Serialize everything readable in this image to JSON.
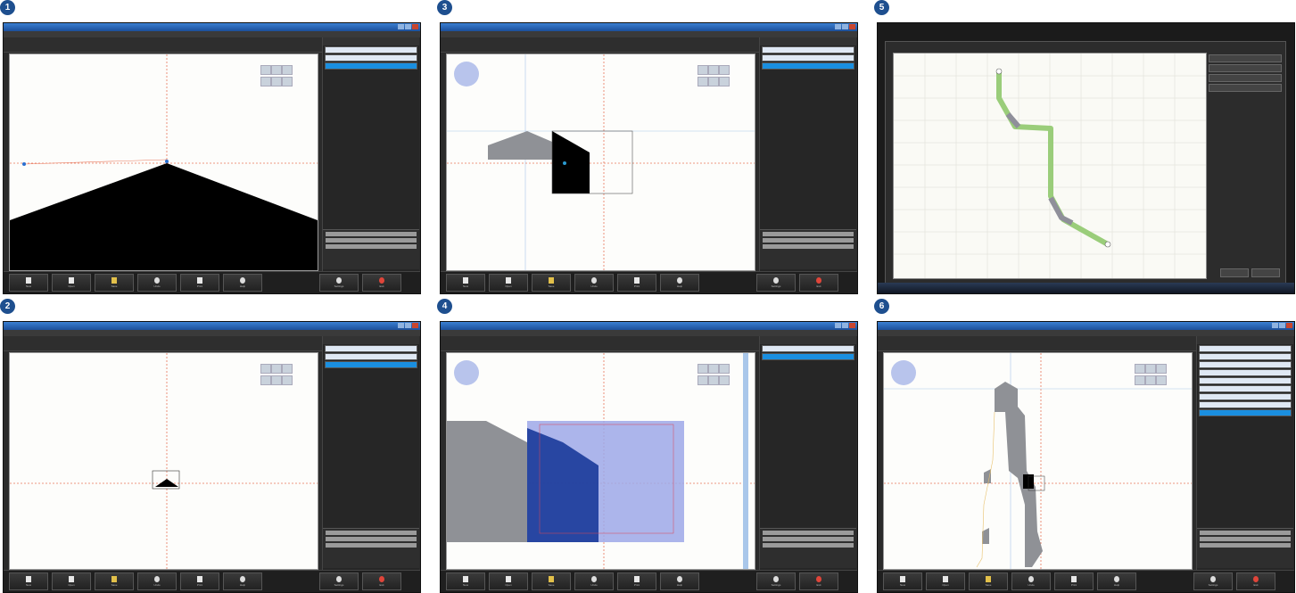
{
  "panels": [
    {
      "number": "1"
    },
    {
      "number": "2"
    },
    {
      "number": "3"
    },
    {
      "number": "4"
    },
    {
      "number": "5"
    },
    {
      "number": "6"
    }
  ],
  "colors": {
    "badge": "#1e4f8f",
    "titlebar": "#2b6cc4",
    "app_background": "#2b2b2b",
    "canvas": "#fdfdfb",
    "axis": "#e8765a",
    "profile_fill": "#000000",
    "profile_grey": "#8f9196",
    "selection_blue": "#1a3a9a",
    "overlay_lavender": "#9ea8e8",
    "path_green": "#9acd7a",
    "exit_button": "#e0453a"
  },
  "bottom_toolbar": {
    "buttons": [
      "New",
      "Open",
      "Save",
      "Undo",
      "Print",
      "Help",
      "Settings",
      "Exit"
    ]
  }
}
